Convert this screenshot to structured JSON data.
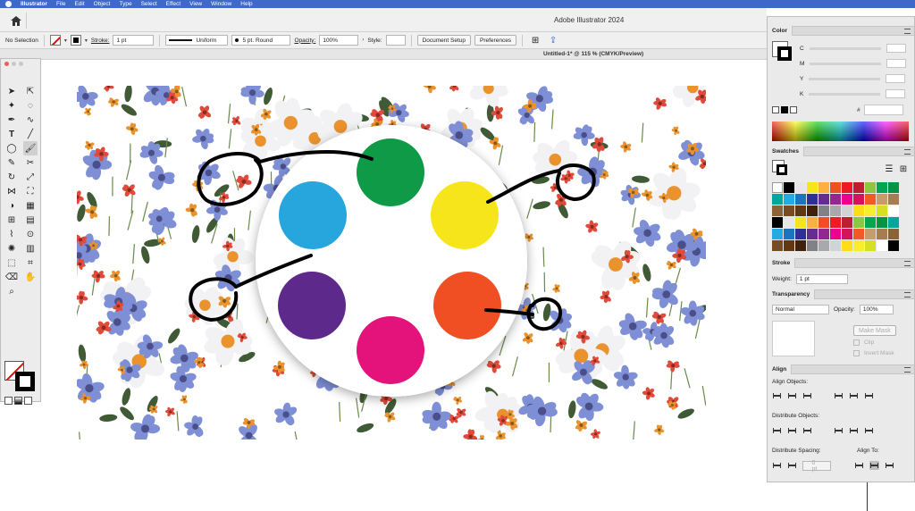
{
  "menubar": {
    "app_name": "Illustrator",
    "items": [
      "File",
      "Edit",
      "Object",
      "Type",
      "Select",
      "Effect",
      "View",
      "Window",
      "Help"
    ]
  },
  "appbar": {
    "window_title": "Adobe Illustrator 2024",
    "home_icon": "home-icon"
  },
  "controlbar": {
    "selection": "No Selection",
    "stroke_label": "Stroke:",
    "stroke_weight": "1 pt",
    "profile": "Uniform",
    "brush": "5 pt. Round",
    "opacity_label": "Opacity:",
    "opacity_value": "100%",
    "style_label": "Style:",
    "document_setup": "Document Setup",
    "preferences": "Preferences"
  },
  "document": {
    "tab_title": "Untitled-1* @ 115 % (CMYK/Preview)"
  },
  "artwork": {
    "circle_colors": [
      "#0f9a48",
      "#f7e51b",
      "#f04e23",
      "#e4137b",
      "#5d2a8c",
      "#27a6de"
    ],
    "pattern_colors": {
      "background": "#ffffff",
      "blue_flower": "#7f8fd6",
      "white_flower": "#f2f2f5",
      "orange": "#e9922e",
      "red": "#e04a3a",
      "leaf": "#3f5a35"
    }
  },
  "panels": {
    "color": {
      "title": "Color",
      "channels": [
        "C",
        "M",
        "Y",
        "K"
      ],
      "hex_symbol": "#"
    },
    "swatches": {
      "title": "Swatches",
      "colors": [
        "#ffffff",
        "#000000",
        "#e6e6e6",
        "#f7e51b",
        "#fbb040",
        "#f04e23",
        "#ed1c24",
        "#be1e2d",
        "#8dc63f",
        "#00a651",
        "#009444",
        "#00a79d",
        "#27aae1",
        "#1c75bc",
        "#2e3192",
        "#662d91",
        "#92278f",
        "#ec008c",
        "#d4145a",
        "#f15a24",
        "#c69c6d",
        "#a67c52",
        "#8c6239",
        "#754c24",
        "#603813",
        "#42210b",
        "#808285",
        "#a7a9ac",
        "#d1d3d4",
        "#ffde17",
        "#f9ed32",
        "#d7df23"
      ]
    },
    "stroke": {
      "title": "Stroke",
      "weight_label": "Weight:",
      "weight_value": "1 pt"
    },
    "transparency": {
      "title": "Transparency",
      "mode": "Normal",
      "opacity_label": "Opacity:",
      "opacity_value": "100%",
      "make_mask": "Make Mask",
      "clip": "Clip",
      "invert_mask": "Invert Mask"
    },
    "align": {
      "title": "Align",
      "align_objects": "Align Objects:",
      "distribute_objects": "Distribute Objects:",
      "distribute_spacing": "Distribute Spacing:",
      "align_to": "Align To:",
      "spacing_value": "0 pt"
    }
  }
}
